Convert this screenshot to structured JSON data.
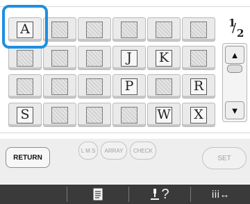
{
  "pattern_grid": {
    "cells": [
      {
        "char": "A",
        "style": "plain",
        "selected": true
      },
      {
        "char": "",
        "style": "ornate"
      },
      {
        "char": "",
        "style": "ornate"
      },
      {
        "char": "",
        "style": "ornate"
      },
      {
        "char": "",
        "style": "ornate"
      },
      {
        "char": "",
        "style": "ornate"
      },
      {
        "char": "",
        "style": "ornate"
      },
      {
        "char": "",
        "style": "ornate"
      },
      {
        "char": "",
        "style": "ornate"
      },
      {
        "char": "J",
        "style": "plain"
      },
      {
        "char": "K",
        "style": "plain"
      },
      {
        "char": "",
        "style": "ornate"
      },
      {
        "char": "",
        "style": "ornate"
      },
      {
        "char": "",
        "style": "ornate"
      },
      {
        "char": "",
        "style": "ornate"
      },
      {
        "char": "P",
        "style": "plain"
      },
      {
        "char": "",
        "style": "ornate"
      },
      {
        "char": "R",
        "style": "plain"
      },
      {
        "char": "S",
        "style": "plain"
      },
      {
        "char": "",
        "style": "ornate"
      },
      {
        "char": "",
        "style": "ornate"
      },
      {
        "char": "",
        "style": "ornate"
      },
      {
        "char": "W",
        "style": "plain"
      },
      {
        "char": "X",
        "style": "plain"
      }
    ]
  },
  "page_indicator": {
    "current": "1",
    "separator": "/",
    "total": "2"
  },
  "scroll": {
    "up_icon": "triangle-up",
    "down_icon": "triangle-down"
  },
  "bottom": {
    "return_label": "RETURN",
    "lms_label": "L M S",
    "array_label": "ARRAY",
    "check_label": "CHECK",
    "set_label": "SET"
  },
  "footer": {
    "items": [
      {
        "icon": "document-list-icon"
      },
      {
        "icon": "needle-help-icon",
        "text": "?"
      },
      {
        "icon": "stitch-width-icon",
        "text": "ⅰⅰⅰ↔"
      }
    ]
  }
}
